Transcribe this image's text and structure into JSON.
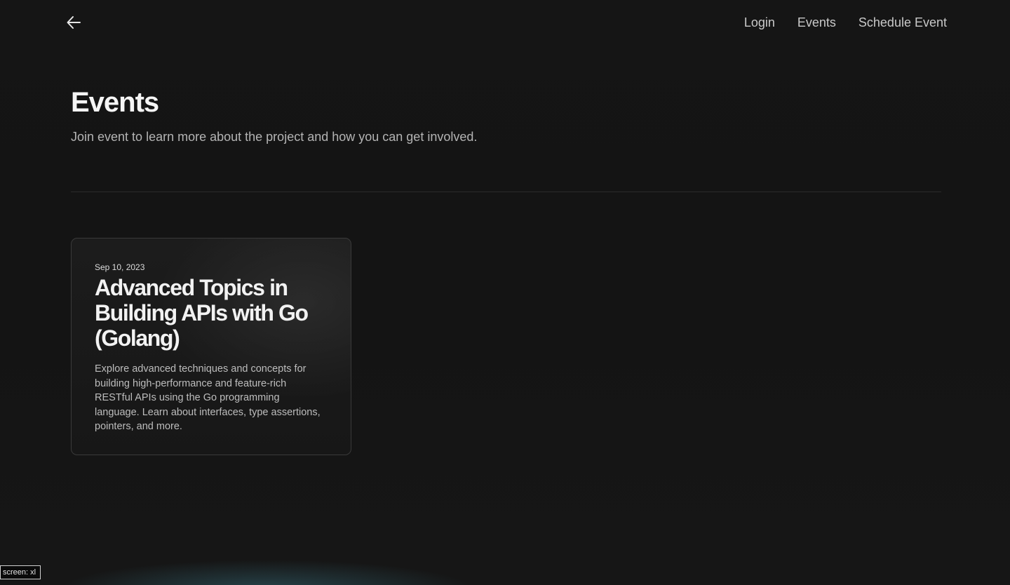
{
  "header": {
    "back_icon": "arrow-left-icon",
    "nav": [
      {
        "label": "Login"
      },
      {
        "label": "Events"
      },
      {
        "label": "Schedule Event"
      }
    ]
  },
  "main": {
    "title": "Events",
    "subtitle": "Join event to learn more about the project and how you can get involved.",
    "events": [
      {
        "date": "Sep 10, 2023",
        "title": "Advanced Topics in Building APIs with Go (Golang)",
        "description": "Explore advanced techniques and concepts for building high-performance and feature-rich RESTful APIs using the Go programming language. Learn about interfaces, type assertions, pointers, and more."
      }
    ]
  },
  "debug": {
    "screen_label": "screen: xl"
  },
  "colors": {
    "background": "#141414",
    "card_border": "#3a3a3a",
    "text_primary": "#f2f2f2",
    "text_secondary": "#bdbdbd"
  }
}
